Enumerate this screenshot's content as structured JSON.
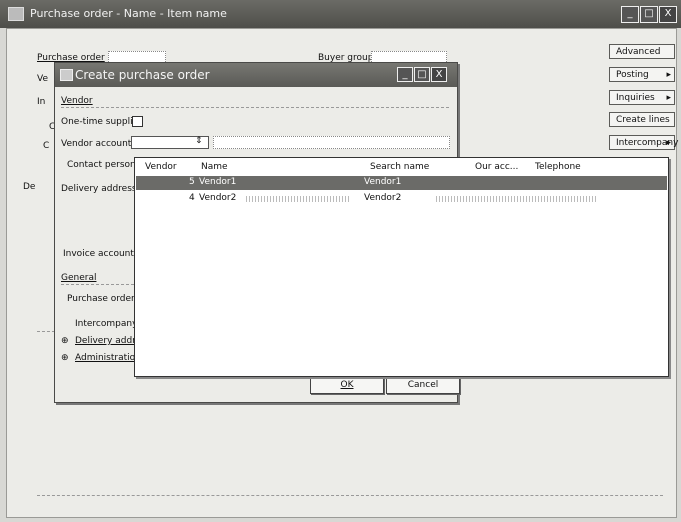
{
  "main": {
    "title": "Purchase order -  Name - Item name",
    "labels": {
      "purchase_order": "Purchase order",
      "buyer_group": "Buyer group",
      "frag_ve": "Ve",
      "frag_in": "In",
      "frag_c1": "C",
      "frag_c2": "C",
      "frag_de": "De"
    },
    "window_buttons": {
      "minimize": "_",
      "maximize": "□",
      "close": "X"
    },
    "side_buttons": [
      {
        "label": "Advanced",
        "arrow": ""
      },
      {
        "label": "Posting",
        "arrow": "▸"
      },
      {
        "label": "Inquiries",
        "arrow": "▸"
      },
      {
        "label": "Create lines",
        "arrow": ""
      },
      {
        "label": "Intercompany",
        "arrow": "▸"
      }
    ]
  },
  "dialog": {
    "title": "Create purchase order",
    "tab_vendor": "Vendor",
    "one_time_supplier": "One-time supplier",
    "vendor_account": "Vendor account",
    "contact_person": "Contact person",
    "delivery_address": "Delivery address",
    "invoice_account": "Invoice account",
    "tab_general": "General",
    "purchase_order": "Purchase order",
    "intercompany": "Intercompany",
    "delivery_address_group": "Delivery address",
    "administration_group": "Administration",
    "ok_label": "OK",
    "cancel_label": "Cancel"
  },
  "lookup": {
    "columns": [
      "Vendor",
      "Name",
      "Search name",
      "Our acc...",
      "Telephone"
    ],
    "rows": [
      {
        "vendor": "5",
        "name": "Vendor1",
        "search_name": "Vendor1",
        "selected": true
      },
      {
        "vendor": "4",
        "name": "Vendor2",
        "search_name": "Vendor2",
        "selected": false
      }
    ]
  },
  "colors": {
    "title_bar": "#5a5a56",
    "selection": "#6b6b68",
    "window_bg": "#ecece8"
  }
}
